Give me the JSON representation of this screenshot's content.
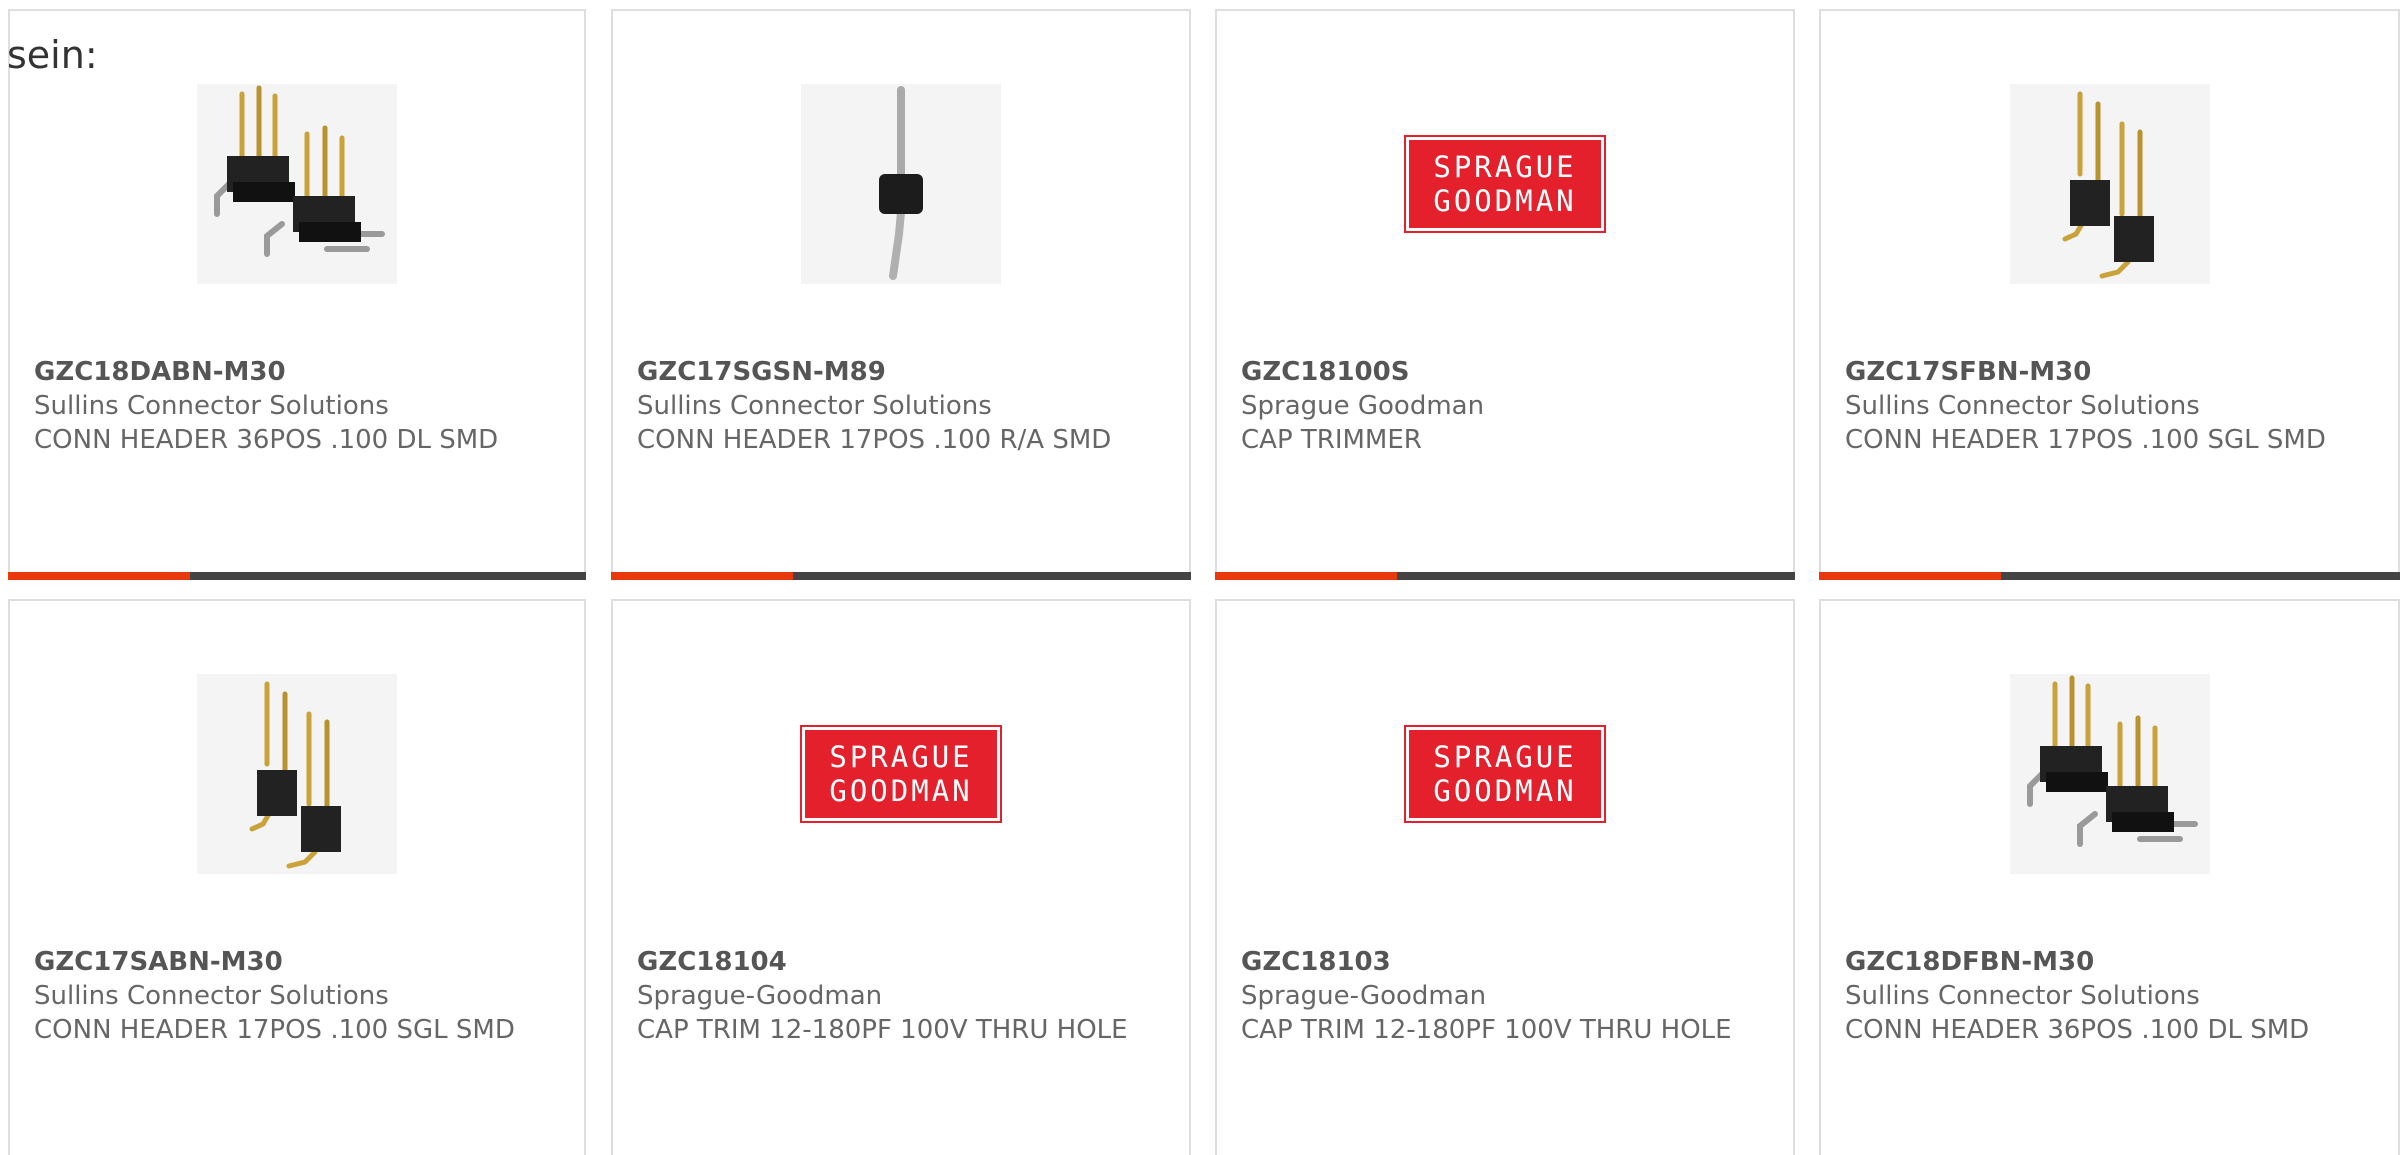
{
  "intro_text": "sein:",
  "colors": {
    "accent_bar": "#e8380d",
    "bar_dark": "#444444",
    "logo_red": "#e3202c"
  },
  "products": [
    {
      "part_number": "GZC18DABN-M30",
      "manufacturer": "Sullins Connector Solutions",
      "description": "CONN HEADER 36POS .100 DL SMD",
      "image": "dual-row-pin-header-image"
    },
    {
      "part_number": "GZC17SGSN-M89",
      "manufacturer": "Sullins Connector Solutions",
      "description": "CONN HEADER 17POS .100 R/A SMD",
      "image": "single-pin-header-image"
    },
    {
      "part_number": "GZC18100S",
      "manufacturer": "Sprague Goodman",
      "description": "CAP TRIMMER",
      "image": "sprague-goodman-logo",
      "logo_line1": "SPRAGUE",
      "logo_line2": "GOODMAN"
    },
    {
      "part_number": "GZC17SFBN-M30",
      "manufacturer": "Sullins Connector Solutions",
      "description": "CONN HEADER 17POS .100 SGL SMD",
      "image": "single-row-pin-header-image"
    },
    {
      "part_number": "GZC17SABN-M30",
      "manufacturer": "Sullins Connector Solutions",
      "description": "CONN HEADER 17POS .100 SGL SMD",
      "image": "single-row-pin-header-image"
    },
    {
      "part_number": "GZC18104",
      "manufacturer": "Sprague-Goodman",
      "description": "CAP TRIM 12-180PF 100V THRU HOLE",
      "image": "sprague-goodman-logo",
      "logo_line1": "SPRAGUE",
      "logo_line2": "GOODMAN"
    },
    {
      "part_number": "GZC18103",
      "manufacturer": "Sprague-Goodman",
      "description": "CAP TRIM 12-180PF 100V THRU HOLE",
      "image": "sprague-goodman-logo",
      "logo_line1": "SPRAGUE",
      "logo_line2": "GOODMAN"
    },
    {
      "part_number": "GZC18DFBN-M30",
      "manufacturer": "Sullins Connector Solutions",
      "description": "CONN HEADER 36POS .100 DL SMD",
      "image": "dual-row-pin-header-image"
    }
  ]
}
